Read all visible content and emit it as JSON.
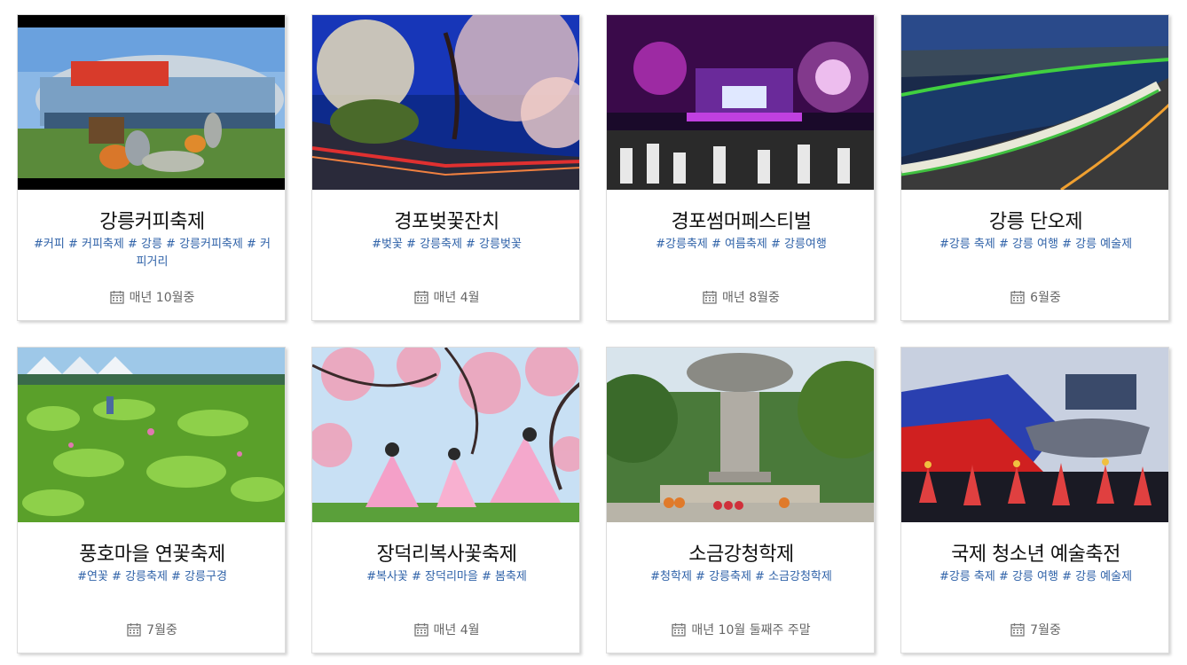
{
  "cards": [
    {
      "title": "강릉커피축제",
      "tags": "#커피 # 커피축제 # 강릉 # 강릉커피축제 # 커피거리",
      "date": "매년 10월중",
      "image": "stadium-coffee-festival-photo"
    },
    {
      "title": "경포벚꽃잔치",
      "tags": "#벚꽃 # 강릉축제 # 강릉벚꽃",
      "date": "매년 4월",
      "image": "cherry-blossom-night-photo"
    },
    {
      "title": "경포썸머페스티벌",
      "tags": "#강릉축제 # 여름축제 # 강릉여행",
      "date": "매년 8월중",
      "image": "summer-concert-stage-photo"
    },
    {
      "title": "강릉 단오제",
      "tags": "#강릉 축제 # 강릉 여행 # 강릉 예술제",
      "date": "6월중",
      "image": "dano-festival-riverside-photo"
    },
    {
      "title": "풍호마을 연꽃축제",
      "tags": "#연꽃 # 강릉축제 # 강릉구경",
      "date": "7월중",
      "image": "lotus-field-photo"
    },
    {
      "title": "장덕리복사꽃축제",
      "tags": "#복사꽃 # 장덕리마을 # 봄축제",
      "date": "매년 4월",
      "image": "peach-blossom-hanbok-photo"
    },
    {
      "title": "소금강청학제",
      "tags": "#청학제 # 강릉축제 # 소금강청학제",
      "date": "매년 10월 둘째주 주말",
      "image": "stone-monument-ritual-photo"
    },
    {
      "title": "국제 청소년 예술축전",
      "tags": "#강릉 축제 # 강릉 여행 # 강릉 예술제",
      "date": "7월중",
      "image": "youth-arts-stage-photo"
    }
  ],
  "colors": {
    "tag": "#2f62a8",
    "title": "#111111",
    "date": "#666666"
  },
  "icons": {
    "date": "calendar-icon"
  }
}
